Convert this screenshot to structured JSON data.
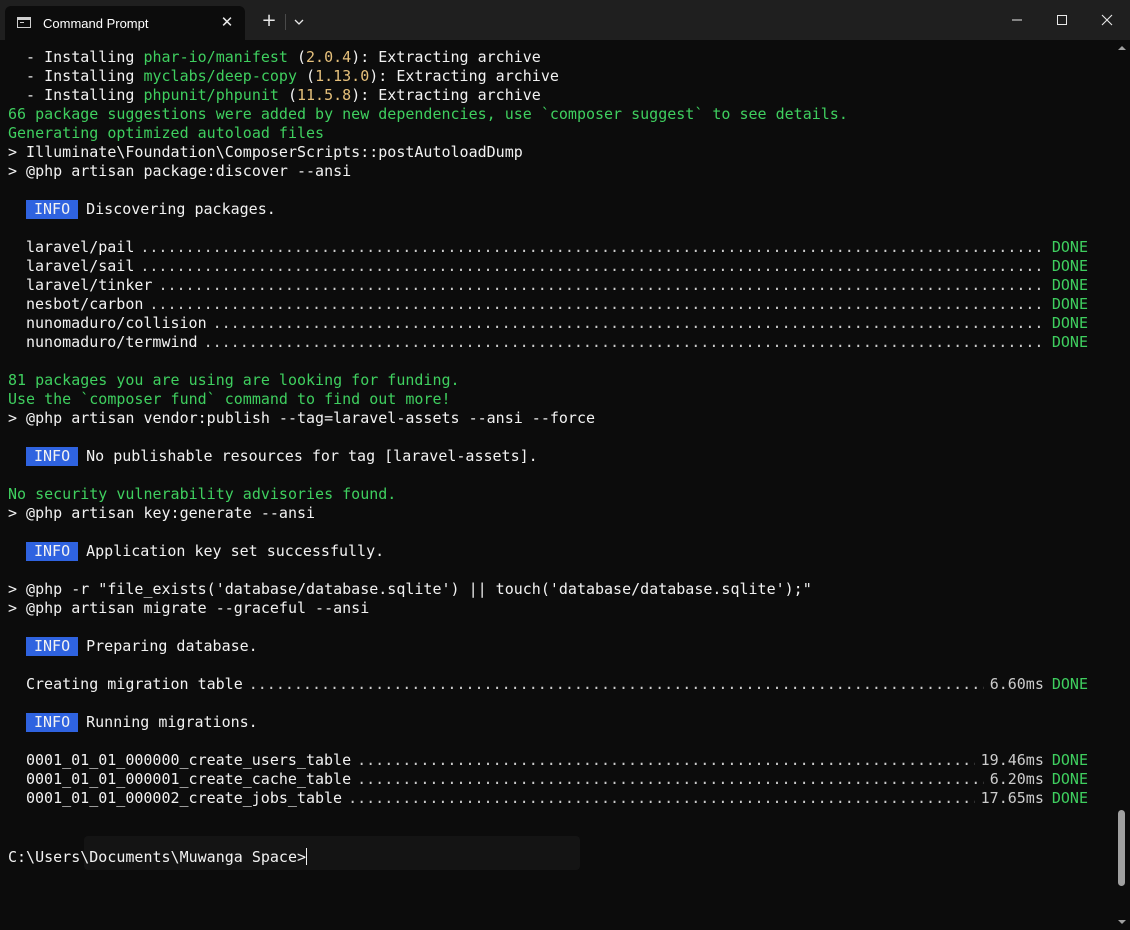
{
  "window": {
    "tab_title": "Command Prompt",
    "close_tab_symbol": "✕",
    "new_tab_symbol": "+"
  },
  "output": {
    "install_1": {
      "prefix": "  - Installing ",
      "pkg": "phar-io/manifest",
      "open": " (",
      "ver": "2.0.4",
      "rest": "): Extracting archive"
    },
    "install_2": {
      "prefix": "  - Installing ",
      "pkg": "myclabs/deep-copy",
      "open": " (",
      "ver": "1.13.0",
      "rest": "): Extracting archive"
    },
    "install_3": {
      "prefix": "  - Installing ",
      "pkg": "phpunit/phpunit",
      "open": " (",
      "ver": "11.5.8",
      "rest": "): Extracting archive"
    },
    "suggestions": "66 package suggestions were added by new dependencies, use `composer suggest` to see details.",
    "generating": "Generating optimized autoload files",
    "cmd_post_autoload": "> Illuminate\\Foundation\\ComposerScripts::postAutoloadDump",
    "cmd_discover": "> @php artisan package:discover --ansi",
    "info_label": "INFO",
    "discovering": "Discovering packages.",
    "packages": [
      {
        "name": "laravel/pail",
        "status": "DONE"
      },
      {
        "name": "laravel/sail",
        "status": "DONE"
      },
      {
        "name": "laravel/tinker",
        "status": "DONE"
      },
      {
        "name": "nesbot/carbon",
        "status": "DONE"
      },
      {
        "name": "nunomaduro/collision",
        "status": "DONE"
      },
      {
        "name": "nunomaduro/termwind",
        "status": "DONE"
      }
    ],
    "funding_1": "81 packages you are using are looking for funding.",
    "funding_2": "Use the `composer fund` command to find out more!",
    "cmd_vendor_publish": "> @php artisan vendor:publish --tag=laravel-assets --ansi --force",
    "no_publishable": "No publishable resources for tag [laravel-assets].",
    "no_vulnerability": "No security vulnerability advisories found.",
    "cmd_key_generate": "> @php artisan key:generate --ansi",
    "key_set": "Application key set successfully.",
    "cmd_file_exists": "> @php -r \"file_exists('database/database.sqlite') || touch('database/database.sqlite');\"",
    "cmd_migrate": "> @php artisan migrate --graceful --ansi",
    "preparing_db": "Preparing database.",
    "creating_table": {
      "name": "Creating migration table",
      "time": "6.60ms",
      "status": "DONE"
    },
    "running_migrations": "Running migrations.",
    "migrations": [
      {
        "name": "0001_01_01_000000_create_users_table",
        "time": "19.46ms",
        "status": "DONE"
      },
      {
        "name": "0001_01_01_000001_create_cache_table",
        "time": "6.20ms",
        "status": "DONE"
      },
      {
        "name": "0001_01_01_000002_create_jobs_table",
        "time": "17.65ms",
        "status": "DONE"
      }
    ]
  },
  "prompt": {
    "path": "C:\\Users\\Documents\\Muwanga Space>"
  },
  "colors": {
    "success_green": "#3fcf5f",
    "info_blue": "#2f63e0",
    "version_yellow": "#e5c07b",
    "background": "#0c0c0c"
  },
  "icons": {
    "tab": "cmd-icon",
    "dropdown": "chevron-down-icon",
    "minimize": "minimize-icon",
    "maximize": "maximize-icon",
    "close": "close-icon"
  }
}
